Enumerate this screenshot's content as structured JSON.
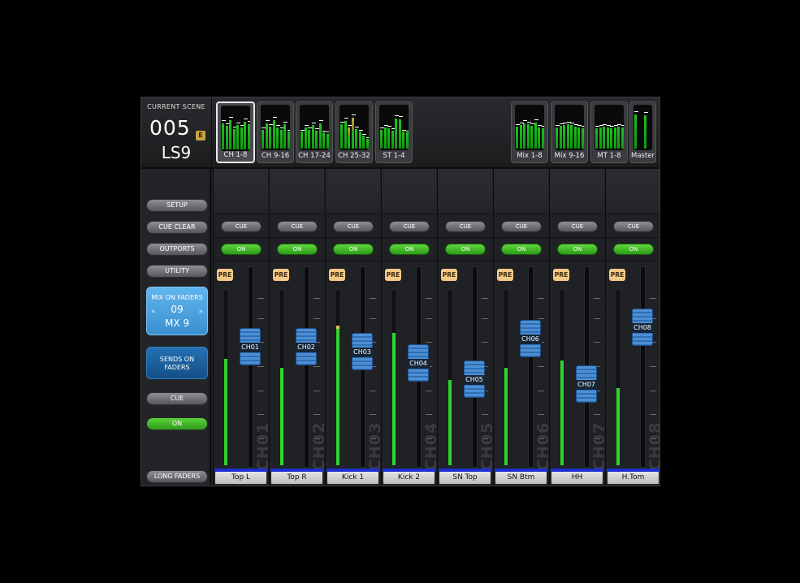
{
  "scene": {
    "label": "CURRENT SCENE",
    "number": "005",
    "edit_badge": "E",
    "name": "LS9"
  },
  "banks": [
    {
      "label": "CH 1-8",
      "selected": true
    },
    {
      "label": "CH 9-16",
      "selected": false
    },
    {
      "label": "CH 17-24",
      "selected": false
    },
    {
      "label": "CH 25-32",
      "selected": false
    },
    {
      "label": "ST 1-4",
      "selected": false
    },
    {
      "label": "Mix 1-8",
      "selected": false
    },
    {
      "label": "Mix 9-16",
      "selected": false
    },
    {
      "label": "MT 1-8",
      "selected": false
    },
    {
      "label": "Master",
      "selected": false
    }
  ],
  "left": {
    "setup": "SETUP",
    "cue_clear": "CUE CLEAR",
    "outports": "OUTPORTS",
    "utility": "UTILITY",
    "mix_on_faders": {
      "title": "MIX ON FADERS",
      "number": "09",
      "name": "MX 9",
      "left_arrow": "«",
      "right_arrow": "»"
    },
    "sends_on_faders": "SENDS ON FADERS",
    "cue": "CUE",
    "on": "ON",
    "long_faders": "LONG FADERS"
  },
  "channels": [
    {
      "id": "CH01",
      "name": "Top L",
      "cue": "CUE",
      "on": "ON",
      "pre": "PRE",
      "fader_level": 0.62,
      "meter_level": 0.61
    },
    {
      "id": "CH02",
      "name": "Top R",
      "cue": "CUE",
      "on": "ON",
      "pre": "PRE",
      "fader_level": 0.62,
      "meter_level": 0.56
    },
    {
      "id": "CH03",
      "name": "Kick 1",
      "cue": "CUE",
      "on": "ON",
      "pre": "PRE",
      "fader_level": 0.59,
      "meter_level": 0.8
    },
    {
      "id": "CH04",
      "name": "Kick 2",
      "cue": "CUE",
      "on": "ON",
      "pre": "PRE",
      "fader_level": 0.52,
      "meter_level": 0.76
    },
    {
      "id": "CH05",
      "name": "SN Top",
      "cue": "CUE",
      "on": "ON",
      "pre": "PRE",
      "fader_level": 0.42,
      "meter_level": 0.49
    },
    {
      "id": "CH06",
      "name": "SN Btm",
      "cue": "CUE",
      "on": "ON",
      "pre": "PRE",
      "fader_level": 0.67,
      "meter_level": 0.56
    },
    {
      "id": "CH07",
      "name": "HH",
      "cue": "CUE",
      "on": "ON",
      "pre": "PRE",
      "fader_level": 0.39,
      "meter_level": 0.6
    },
    {
      "id": "CH08",
      "name": "H.Tom",
      "cue": "CUE",
      "on": "ON",
      "pre": "PRE",
      "fader_level": 0.74,
      "meter_level": 0.44
    }
  ]
}
